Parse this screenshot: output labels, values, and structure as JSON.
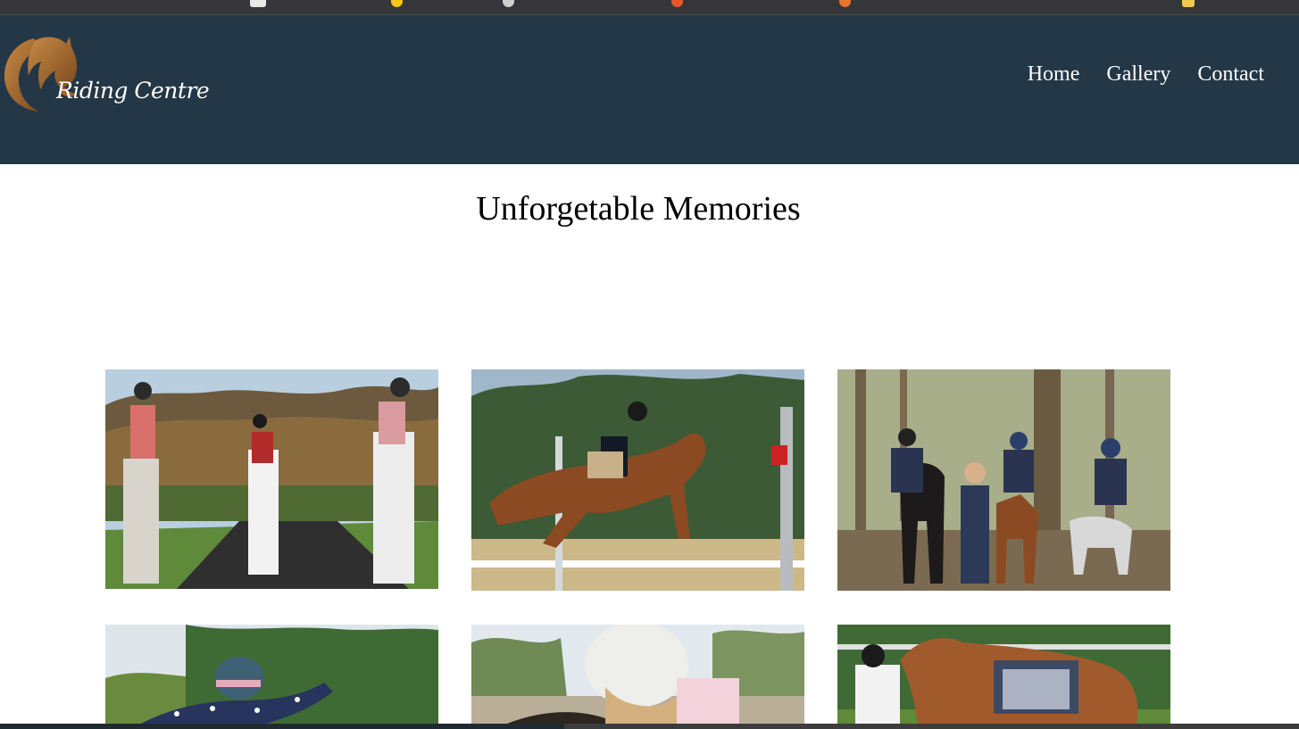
{
  "brand": {
    "logo_text": "Riding Centre"
  },
  "nav": {
    "items": [
      {
        "label": "Home"
      },
      {
        "label": "Gallery"
      },
      {
        "label": "Contact"
      }
    ]
  },
  "main": {
    "heading": "Unforgetable Memories"
  },
  "gallery": {
    "photos": [
      {
        "subject": "three riders on a lane"
      },
      {
        "subject": "horse jumping a fence"
      },
      {
        "subject": "riders in woodland"
      },
      {
        "subject": "child with arms outstretched"
      },
      {
        "subject": "rider in white helmet"
      },
      {
        "subject": "rider with chestnut horse"
      }
    ]
  },
  "colors": {
    "header_bg": "#243746",
    "page_bg": "#ffffff",
    "logo_gold": "#a0642a"
  }
}
